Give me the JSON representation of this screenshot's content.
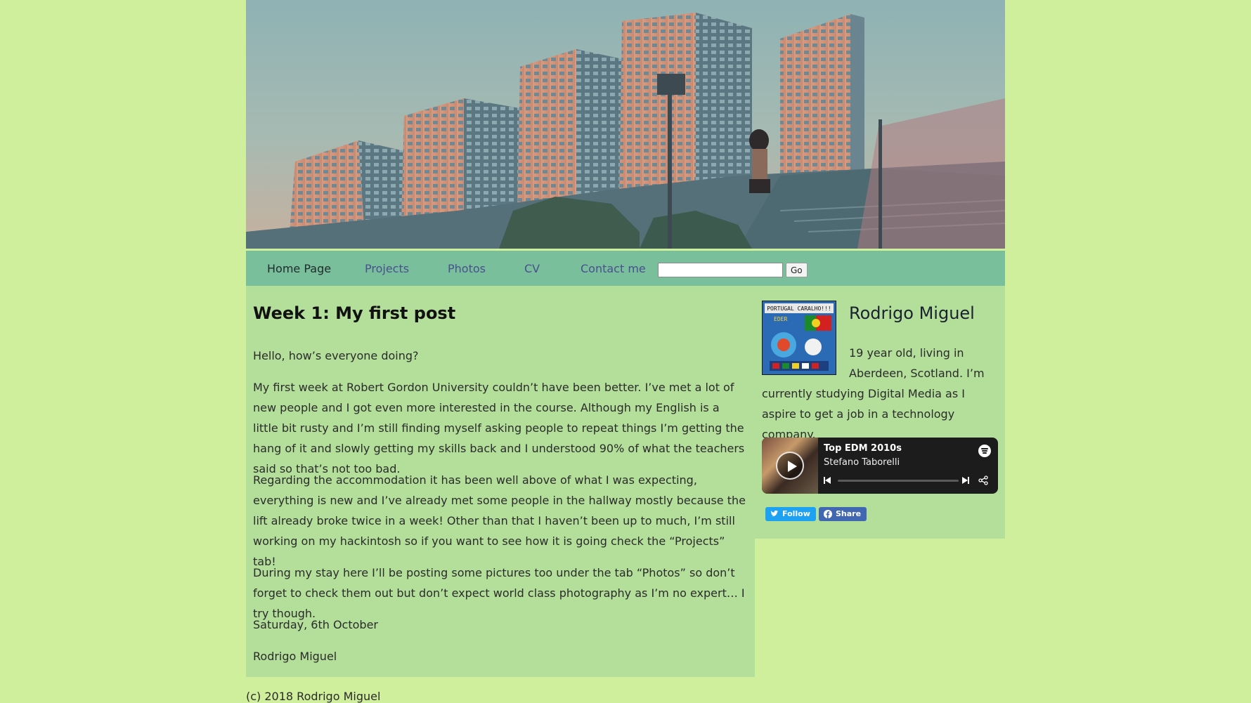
{
  "nav": {
    "items": [
      {
        "label": "Home Page",
        "current": true
      },
      {
        "label": "Projects",
        "current": false
      },
      {
        "label": "Photos",
        "current": false
      },
      {
        "label": "CV",
        "current": false
      },
      {
        "label": "Contact me",
        "current": false
      }
    ],
    "search_value": "",
    "go_label": "Go"
  },
  "post": {
    "title": "Week 1: My first post",
    "paragraphs": [
      "Hello, how’s everyone doing?",
      "My first week at Robert Gordon University couldn’t have been better. I’ve met a lot of new people and I got even more interested in the course. Although my English is a little bit rusty and I’m still finding myself asking people to repeat things I’m getting the hang of it and slowly getting my skills back and I understood 90% of what the teachers said so that’s not too bad.",
      "Regarding the accommodation it has been well above of what I was expecting, everything is new and I’ve already met some people in the hallway mostly because the lift already broke twice in a week! Other than that I haven’t been up to much, I’m still working on my hackintosh so if you want to see how it is going check the “Projects” tab!",
      "During my stay here I’ll be posting some pictures too under the tab “Photos” so don’t forget to check them out but don’t expect world class photography as I’m no expert… I try though.",
      "Saturday, 6th October",
      "Rodrigo Miguel"
    ]
  },
  "sidebar": {
    "avatar_text": "PORTUGAL CARALHO!!!",
    "avatar_sub": "EDER",
    "name": "Rodrigo Miguel",
    "bio_line1": "19 year old, living in",
    "bio_line2": "Aberdeen, Scotland. I’m",
    "bio_rest": "currently studying Digital Media as I aspire to get a job in a technology company."
  },
  "spotify": {
    "title": "Top EDM 2010s",
    "artist": "Stefano Taborelli"
  },
  "social": {
    "twitter_label": "Follow",
    "facebook_label": "Share"
  },
  "footer": {
    "text": "(c) 2018 Rodrigo Miguel"
  },
  "colors": {
    "page_bg": "#d0ef9c",
    "content_bg": "#b3df9a",
    "nav_bg": "#7abf9c",
    "link": "#4a4f8e",
    "twitter": "#1da1f2",
    "facebook": "#4267b2"
  }
}
